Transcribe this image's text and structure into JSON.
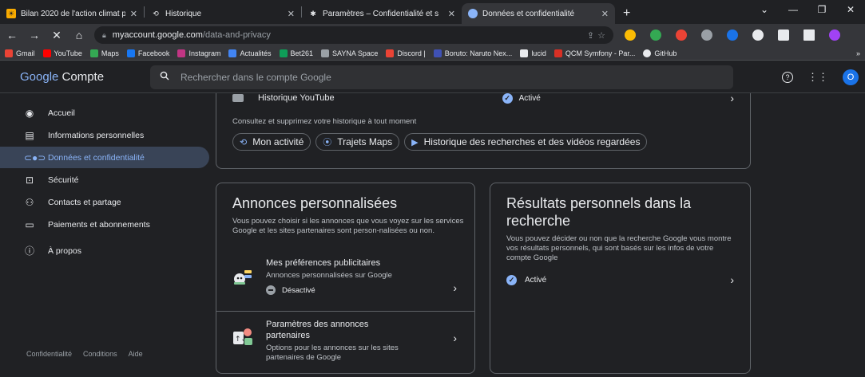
{
  "browser": {
    "tabs": [
      {
        "title": "Bilan 2020 de l'action climat par",
        "favicon_color": "#f9ab00"
      },
      {
        "title": "Historique",
        "favicon_color": "#9aa0a6"
      },
      {
        "title": "Paramètres – Confidentialité et s",
        "favicon_color": "#9aa0a6"
      },
      {
        "title": "Données et confidentialité",
        "favicon_color": "#8ab4f8"
      }
    ],
    "url_host": "myaccount.google.com",
    "url_path": "/data-and-privacy",
    "bookmarks": [
      {
        "label": "Gmail",
        "color": "#ea4335"
      },
      {
        "label": "YouTube",
        "color": "#ff0000"
      },
      {
        "label": "Maps",
        "color": "#34a853"
      },
      {
        "label": "Facebook",
        "color": "#1877f2"
      },
      {
        "label": "Instagram",
        "color": "#c13584"
      },
      {
        "label": "Actualités",
        "color": "#4285f4"
      },
      {
        "label": "Bet261",
        "color": "#0f9d58"
      },
      {
        "label": "SAYNA Space",
        "color": "#9aa0a6"
      },
      {
        "label": "Discord |",
        "color": "#ea4335"
      },
      {
        "label": "Boruto: Naruto Nex...",
        "color": "#3f51b5"
      },
      {
        "label": "lucid",
        "color": "#e8eaed"
      },
      {
        "label": "QCM Symfony - Par...",
        "color": "#d93025"
      },
      {
        "label": "GitHub",
        "color": "#e8eaed"
      }
    ]
  },
  "header": {
    "app_name_google": "Google",
    "app_name_account": "Compte",
    "search_placeholder": "Rechercher dans le compte Google",
    "avatar_letter": "O"
  },
  "sidebar": {
    "items": [
      {
        "label": "Accueil",
        "icon": "person-circle-icon"
      },
      {
        "label": "Informations personnelles",
        "icon": "id-card-icon"
      },
      {
        "label": "Données et confidentialité",
        "icon": "toggle-icon"
      },
      {
        "label": "Sécurité",
        "icon": "lock-icon"
      },
      {
        "label": "Contacts et partage",
        "icon": "people-icon"
      },
      {
        "label": "Paiements et abonnements",
        "icon": "credit-card-icon"
      },
      {
        "label": "À propos",
        "icon": "info-icon"
      }
    ],
    "footer": [
      "Confidentialité",
      "Conditions",
      "Aide"
    ]
  },
  "youtube_history": {
    "title": "Historique YouTube",
    "status": "Activé",
    "description": "Consultez et supprimez votre historique à tout moment",
    "chips": [
      "Mon activité",
      "Trajets Maps",
      "Historique des recherches et des vidéos regardées"
    ]
  },
  "ads_card": {
    "title": "Annonces personnalisées",
    "description": "Vous pouvez choisir si les annonces que vous voyez sur les services Google et les sites partenaires sont person-nalisées ou non.",
    "items": [
      {
        "title": "Mes préférences publicitaires",
        "description": "Annonces personnalisées sur Google",
        "status": "Désactivé"
      },
      {
        "title": "Paramètres des annonces partenaires",
        "description": "Options pour les annonces sur les sites partenaires de Google"
      }
    ]
  },
  "results_card": {
    "title": "Résultats personnels dans la recherche",
    "description": "Vous pouvez décider ou non que la recherche Google vous montre vos résultats personnels, qui sont basés sur les infos de votre compte Google",
    "status": "Activé"
  }
}
